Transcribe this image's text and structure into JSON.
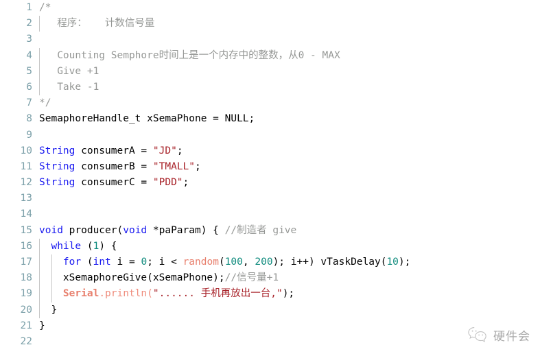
{
  "editor": {
    "language": "arduino-cpp",
    "background_color": "#ffffff",
    "line_number_color": "#7a9fa8",
    "indent_guide_color": "#c6c6c6",
    "theme_colors": {
      "comment": "#969896",
      "keyword": "#1a1af0",
      "string": "#a8232a",
      "number": "#0d8a7c",
      "function": "#e8806e",
      "object": "#e8806e",
      "plain": "#000000"
    },
    "first_line_number": 1,
    "last_line_number": 22,
    "total_lines_visible": 22
  },
  "watermark": {
    "icon_name": "wechat-logo-icon",
    "text": "硬件会"
  },
  "lines": [
    {
      "num": "1",
      "indent_guides": 0,
      "tokens": [
        {
          "t": "comment",
          "v": "/*"
        }
      ]
    },
    {
      "num": "2",
      "indent_guides": 1,
      "tokens": [
        {
          "t": "comment",
          "v": "   程序：   计数信号量"
        }
      ]
    },
    {
      "num": "3",
      "indent_guides": 1,
      "tokens": [
        {
          "t": "comment",
          "v": ""
        }
      ]
    },
    {
      "num": "4",
      "indent_guides": 1,
      "tokens": [
        {
          "t": "comment",
          "v": "   Counting Semphore时间上是一个内存中的整数，从0 - MAX"
        }
      ]
    },
    {
      "num": "5",
      "indent_guides": 1,
      "tokens": [
        {
          "t": "comment",
          "v": "   Give +1"
        }
      ]
    },
    {
      "num": "6",
      "indent_guides": 1,
      "tokens": [
        {
          "t": "comment",
          "v": "   Take -1"
        }
      ]
    },
    {
      "num": "7",
      "indent_guides": 0,
      "tokens": [
        {
          "t": "comment",
          "v": "*/"
        }
      ]
    },
    {
      "num": "8",
      "indent_guides": 0,
      "tokens": [
        {
          "t": "plain",
          "v": "SemaphoreHandle_t xSemaPhone = NULL;"
        }
      ]
    },
    {
      "num": "9",
      "indent_guides": 0,
      "tokens": []
    },
    {
      "num": "10",
      "indent_guides": 0,
      "tokens": [
        {
          "t": "type",
          "v": "String"
        },
        {
          "t": "plain",
          "v": " consumerA = "
        },
        {
          "t": "string",
          "v": "\"JD\""
        },
        {
          "t": "plain",
          "v": ";"
        }
      ]
    },
    {
      "num": "11",
      "indent_guides": 0,
      "tokens": [
        {
          "t": "type",
          "v": "String"
        },
        {
          "t": "plain",
          "v": " consumerB = "
        },
        {
          "t": "string",
          "v": "\"TMALL\""
        },
        {
          "t": "plain",
          "v": ";"
        }
      ]
    },
    {
      "num": "12",
      "indent_guides": 0,
      "tokens": [
        {
          "t": "type",
          "v": "String"
        },
        {
          "t": "plain",
          "v": " consumerC = "
        },
        {
          "t": "string",
          "v": "\"PDD\""
        },
        {
          "t": "plain",
          "v": ";"
        }
      ]
    },
    {
      "num": "13",
      "indent_guides": 0,
      "tokens": []
    },
    {
      "num": "14",
      "indent_guides": 0,
      "tokens": []
    },
    {
      "num": "15",
      "indent_guides": 0,
      "tokens": [
        {
          "t": "keyword",
          "v": "void"
        },
        {
          "t": "plain",
          "v": " producer("
        },
        {
          "t": "keyword",
          "v": "void"
        },
        {
          "t": "plain",
          "v": " *paParam) { "
        },
        {
          "t": "comment",
          "v": "//制造者 give"
        }
      ]
    },
    {
      "num": "16",
      "indent_guides": 1,
      "tokens": [
        {
          "t": "plain",
          "v": "  "
        },
        {
          "t": "keyword",
          "v": "while"
        },
        {
          "t": "plain",
          "v": " ("
        },
        {
          "t": "number",
          "v": "1"
        },
        {
          "t": "plain",
          "v": ") {"
        }
      ]
    },
    {
      "num": "17",
      "indent_guides": 2,
      "tokens": [
        {
          "t": "plain",
          "v": "    "
        },
        {
          "t": "keyword",
          "v": "for"
        },
        {
          "t": "plain",
          "v": " ("
        },
        {
          "t": "keyword",
          "v": "int"
        },
        {
          "t": "plain",
          "v": " i = "
        },
        {
          "t": "number",
          "v": "0"
        },
        {
          "t": "plain",
          "v": "; i < "
        },
        {
          "t": "func",
          "v": "random"
        },
        {
          "t": "plain",
          "v": "("
        },
        {
          "t": "number",
          "v": "100"
        },
        {
          "t": "plain",
          "v": ", "
        },
        {
          "t": "number",
          "v": "200"
        },
        {
          "t": "plain",
          "v": "); i++) vTaskDelay("
        },
        {
          "t": "number",
          "v": "10"
        },
        {
          "t": "plain",
          "v": ");"
        }
      ]
    },
    {
      "num": "18",
      "indent_guides": 2,
      "tokens": [
        {
          "t": "plain",
          "v": "    xSemaphoreGive(xSemaPhone);"
        },
        {
          "t": "comment",
          "v": "//信号量+1"
        }
      ]
    },
    {
      "num": "19",
      "indent_guides": 2,
      "tokens": [
        {
          "t": "plain",
          "v": "    "
        },
        {
          "t": "obj",
          "v": "Serial"
        },
        {
          "t": "method",
          "v": ".println("
        },
        {
          "t": "string",
          "v": "\"...... 手机再放出一台,\""
        },
        {
          "t": "plain",
          "v": ");"
        }
      ]
    },
    {
      "num": "20",
      "indent_guides": 1,
      "tokens": [
        {
          "t": "plain",
          "v": "  }"
        }
      ]
    },
    {
      "num": "21",
      "indent_guides": 0,
      "tokens": [
        {
          "t": "plain",
          "v": "}"
        }
      ]
    },
    {
      "num": "22",
      "indent_guides": 0,
      "tokens": []
    }
  ]
}
